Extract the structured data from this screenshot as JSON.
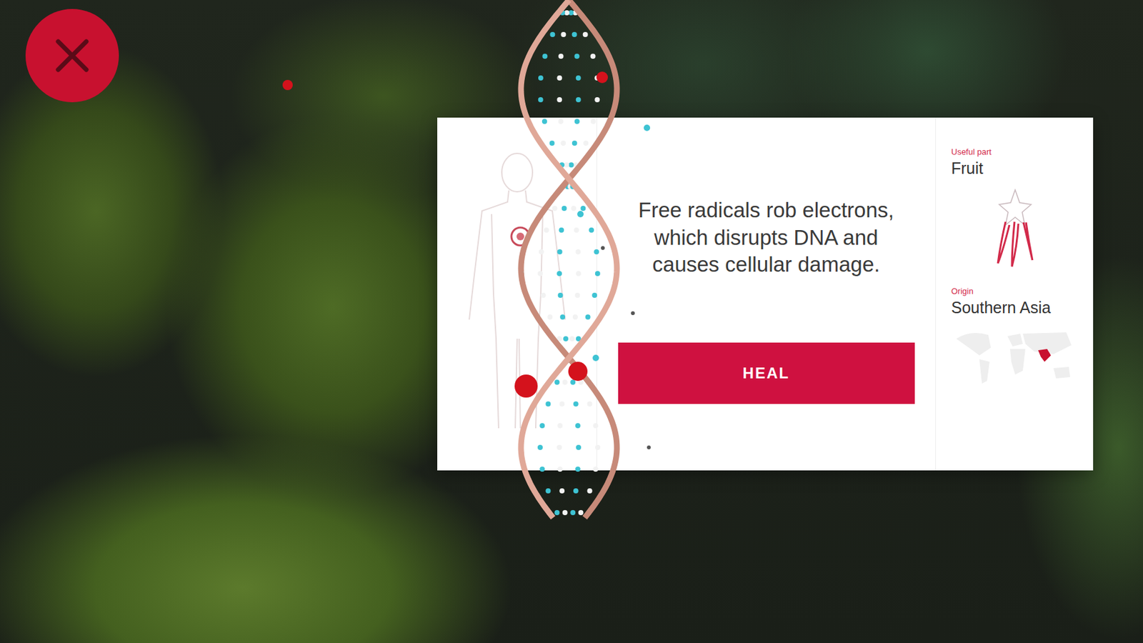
{
  "card": {
    "message_lines": [
      "Free radicals rob electrons,",
      "which disrupts DNA and",
      "causes cellular damage."
    ],
    "action_button": {
      "label": "HEAL"
    },
    "useful_part": {
      "label": "Useful part",
      "value": "Fruit"
    },
    "origin": {
      "label": "Origin",
      "value": "Southern Asia"
    }
  }
}
